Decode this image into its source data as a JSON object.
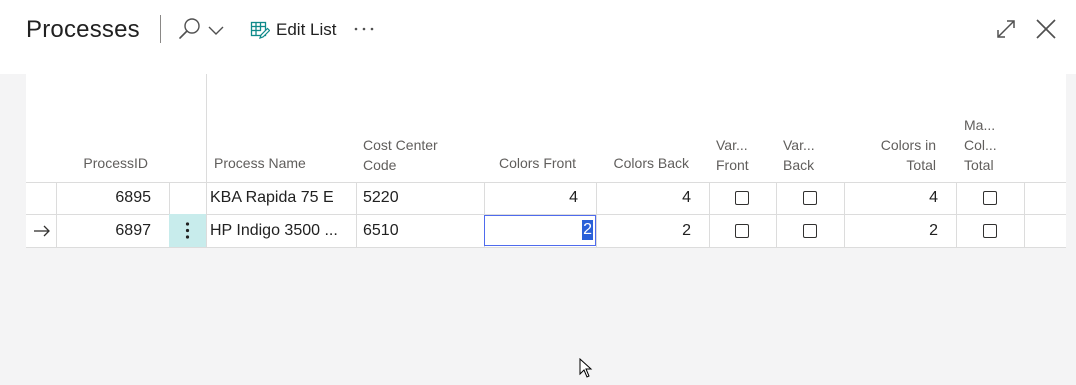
{
  "header": {
    "title": "Processes",
    "edit_list_label": "Edit List"
  },
  "columns": {
    "process_id": "ProcessID",
    "process_name": "Process Name",
    "cost_center_1": "Cost Center",
    "cost_center_2": "Code",
    "colors_front": "Colors Front",
    "colors_back": "Colors Back",
    "var_front_1": "Var...",
    "var_front_2": "Front",
    "var_back_1": "Var...",
    "var_back_2": "Back",
    "colors_total_1": "Colors in",
    "colors_total_2": "Total",
    "max_col_1": "Ma...",
    "max_col_2": "Col...",
    "max_col_3": "Total"
  },
  "rows": [
    {
      "process_id": "6895",
      "process_name": "KBA Rapida 75 E",
      "cost_center": "5220",
      "colors_front": "4",
      "colors_back": "4",
      "var_front": false,
      "var_back": false,
      "colors_total": "4",
      "max_col_total": false
    },
    {
      "process_id": "6897",
      "process_name": "HP Indigo 3500 ...",
      "cost_center": "6510",
      "colors_front": "2",
      "colors_back": "2",
      "var_front": false,
      "var_back": false,
      "colors_total": "2",
      "max_col_total": false,
      "current": true
    }
  ],
  "icons": {
    "search": "search-icon",
    "chevron": "chevron-down-icon",
    "edit_list": "edit-list-icon",
    "more": "more-icon",
    "expand": "expand-icon",
    "close": "close-icon",
    "row_arrow": "arrow-right-icon",
    "row_menu": "vertical-ellipsis-icon"
  },
  "colors": {
    "accent_teal": "#0f8a8a",
    "selection": "#2a60d8",
    "row_menu_bg": "#c8ecec"
  }
}
